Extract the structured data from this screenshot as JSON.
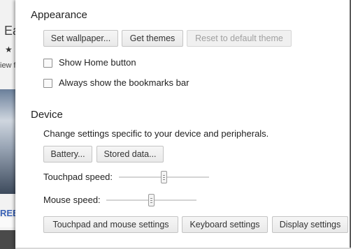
{
  "background_window": {
    "letter": "Ea",
    "star": "★",
    "snippet": "iew f",
    "promo": "REE"
  },
  "appearance": {
    "title": "Appearance",
    "buttons": {
      "set_wallpaper": "Set wallpaper...",
      "get_themes": "Get themes",
      "reset_theme": "Reset to default theme"
    },
    "checkboxes": {
      "show_home": "Show Home button",
      "bookmarks_bar": "Always show the bookmarks bar"
    }
  },
  "device": {
    "title": "Device",
    "description": "Change settings specific to your device and peripherals.",
    "buttons": {
      "battery": "Battery...",
      "stored_data": "Stored data..."
    },
    "touchpad_speed": {
      "label": "Touchpad speed:",
      "level": 0.5
    },
    "mouse_speed": {
      "label": "Mouse speed:",
      "level": 0.5
    },
    "bottom_buttons": {
      "touchpad_mouse": "Touchpad and mouse settings",
      "keyboard": "Keyboard settings",
      "display": "Display settings"
    }
  }
}
